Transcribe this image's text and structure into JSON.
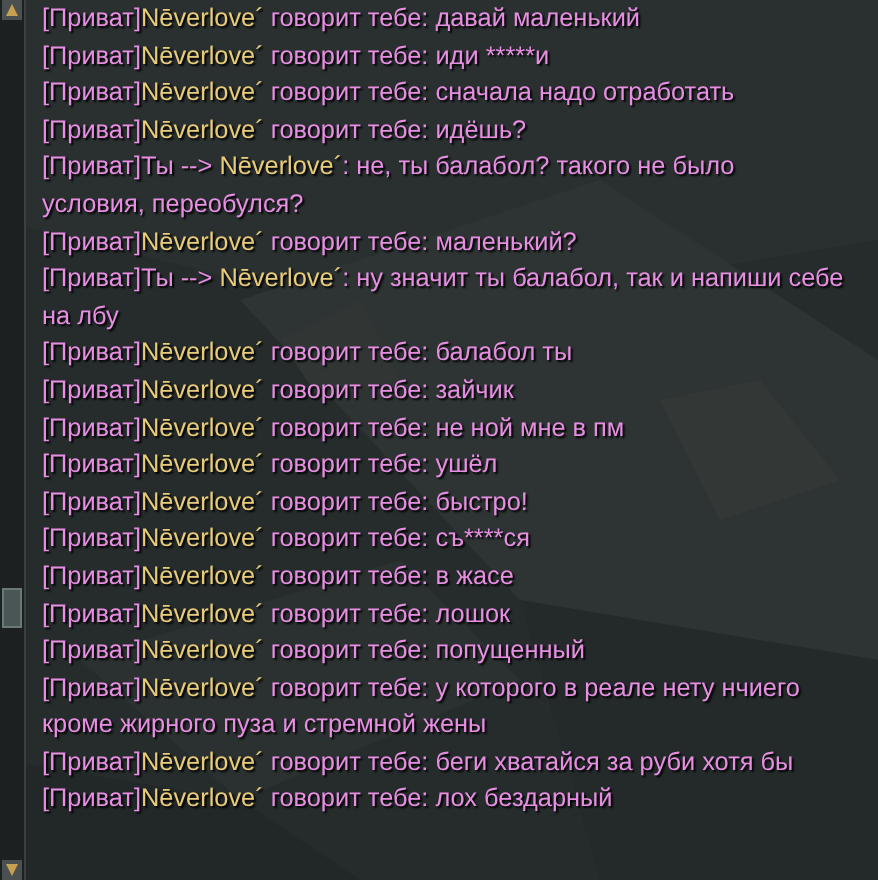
{
  "chat": {
    "messages": [
      {
        "kind": "incoming",
        "channel": "[Приват]",
        "name": "Nēverlove´",
        "verb": " говорит тебе: ",
        "text": "давай маленький"
      },
      {
        "kind": "incoming",
        "channel": "[Приват]",
        "name": "Nēverlove´",
        "verb": " говорит тебе: ",
        "text": "иди *****и"
      },
      {
        "kind": "incoming",
        "channel": "[Приват]",
        "name": "Nēverlove´",
        "verb": " говорит тебе: ",
        "text": "сначала надо отработать"
      },
      {
        "kind": "incoming",
        "channel": "[Приват]",
        "name": "Nēverlove´",
        "verb": " говорит тебе: ",
        "text": "идёшь?"
      },
      {
        "kind": "outgoing",
        "channel": "[Приват]",
        "sender": "Ты --> ",
        "name": "Nēverlove´",
        "verb": ": ",
        "text": "не, ты балабол? такого не было условия, переобулся?"
      },
      {
        "kind": "incoming",
        "channel": "[Приват]",
        "name": "Nēverlove´",
        "verb": " говорит тебе: ",
        "text": "маленький?"
      },
      {
        "kind": "outgoing",
        "channel": "[Приват]",
        "sender": "Ты --> ",
        "name": "Nēverlove´",
        "verb": ": ",
        "text": "ну значит ты балабол, так и напиши себе на лбу"
      },
      {
        "kind": "incoming",
        "channel": "[Приват]",
        "name": "Nēverlove´",
        "verb": " говорит тебе: ",
        "text": "балабол ты"
      },
      {
        "kind": "incoming",
        "channel": "[Приват]",
        "name": "Nēverlove´",
        "verb": " говорит тебе: ",
        "text": "зайчик"
      },
      {
        "kind": "incoming",
        "channel": "[Приват]",
        "name": "Nēverlove´",
        "verb": " говорит тебе: ",
        "text": "не ной мне в пм"
      },
      {
        "kind": "incoming",
        "channel": "[Приват]",
        "name": "Nēverlove´",
        "verb": " говорит тебе: ",
        "text": "ушёл"
      },
      {
        "kind": "incoming",
        "channel": "[Приват]",
        "name": "Nēverlove´",
        "verb": " говорит тебе: ",
        "text": "быстро!"
      },
      {
        "kind": "incoming",
        "channel": "[Приват]",
        "name": "Nēverlove´",
        "verb": " говорит тебе: ",
        "text": "съ****ся"
      },
      {
        "kind": "incoming",
        "channel": "[Приват]",
        "name": "Nēverlove´",
        "verb": " говорит тебе: ",
        "text": "в жасе"
      },
      {
        "kind": "incoming",
        "channel": "[Приват]",
        "name": "Nēverlove´",
        "verb": " говорит тебе: ",
        "text": "лошок"
      },
      {
        "kind": "incoming",
        "channel": "[Приват]",
        "name": "Nēverlove´",
        "verb": " говорит тебе: ",
        "text": "попущенный"
      },
      {
        "kind": "incoming",
        "channel": "[Приват]",
        "name": "Nēverlove´",
        "verb": " говорит тебе: ",
        "text": "у которого в реале нету нчиего кроме жирного пуза и стремной жены"
      },
      {
        "kind": "incoming",
        "channel": "[Приват]",
        "name": "Nēverlove´",
        "verb": " говорит тебе: ",
        "text": "беги хватайся за руби хотя бы"
      },
      {
        "kind": "incoming",
        "channel": "[Приват]",
        "name": "Nēverlove´",
        "verb": " говорит тебе: ",
        "text": "лох бездарный"
      }
    ]
  }
}
